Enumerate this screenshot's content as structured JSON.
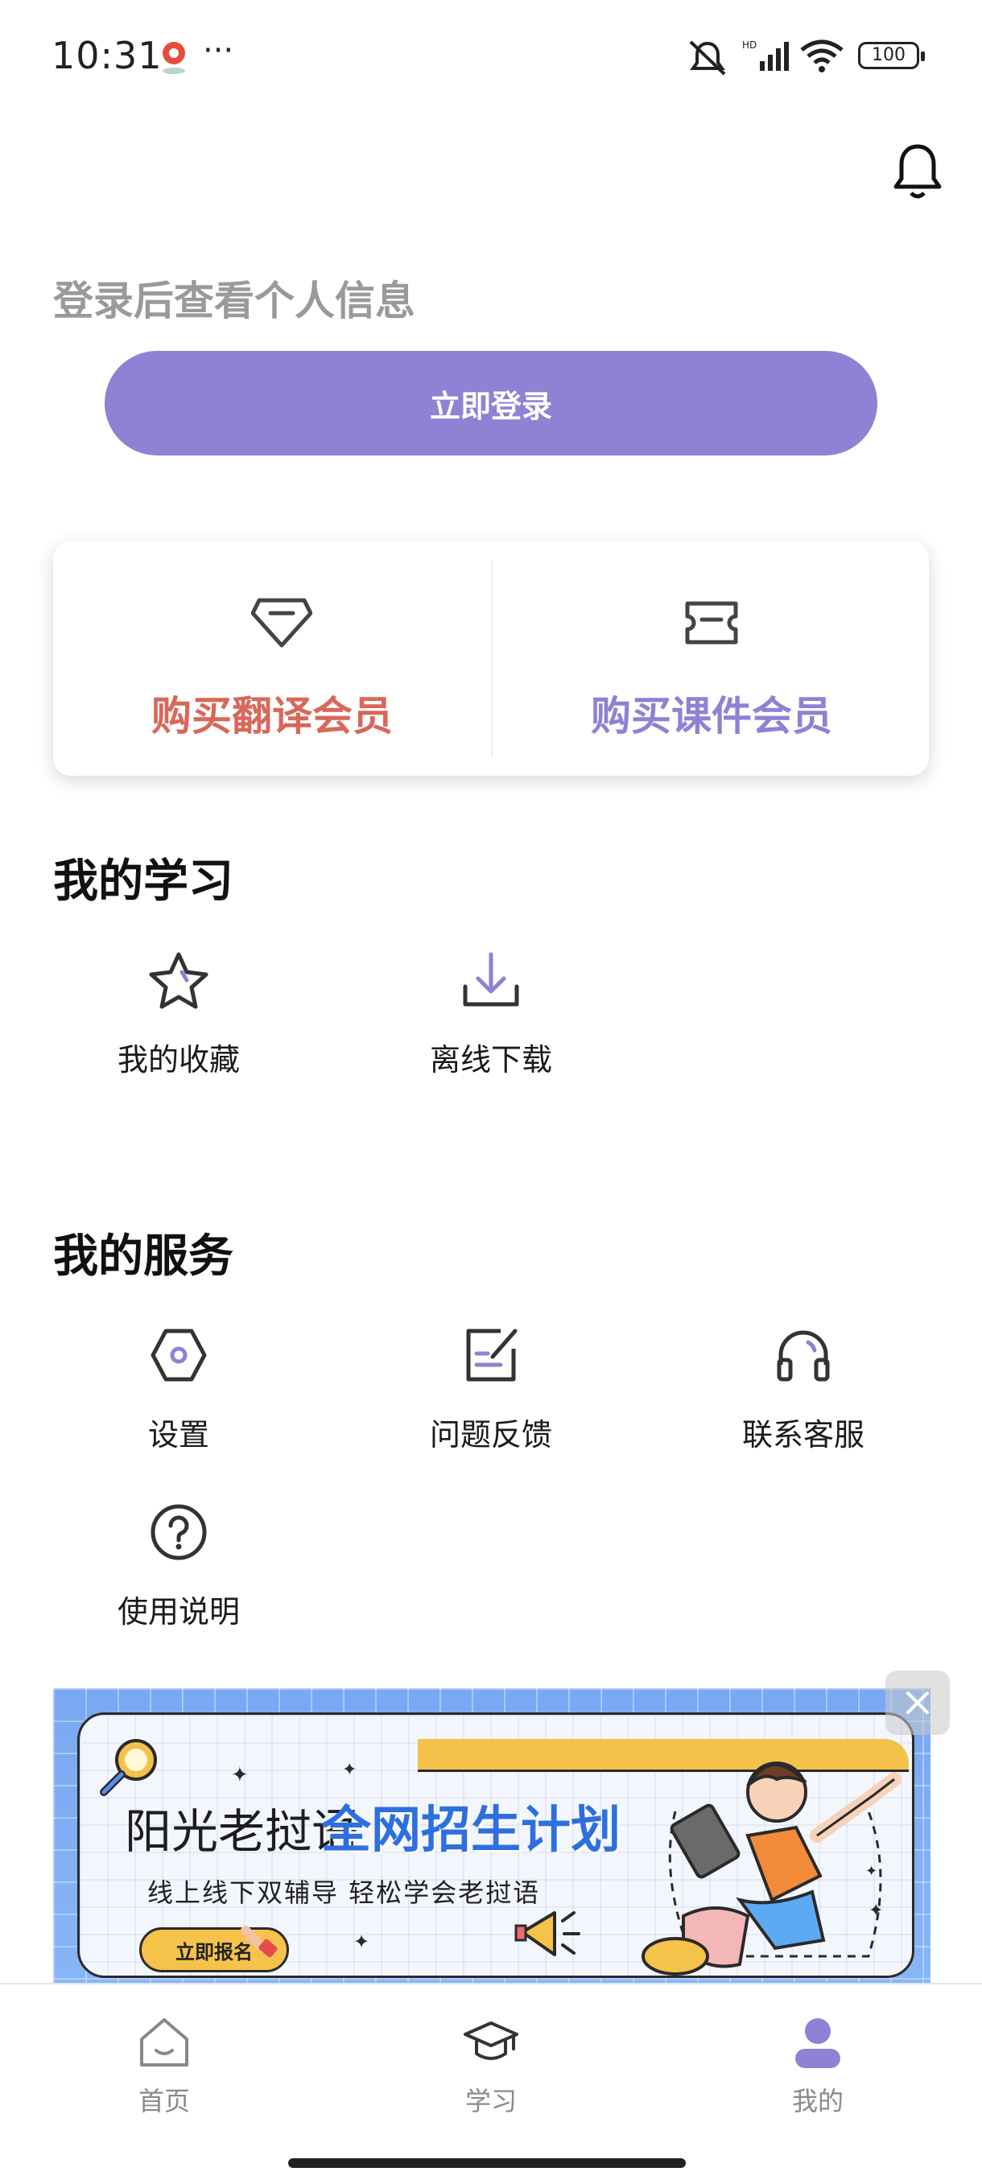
{
  "status_bar": {
    "time": "10:31",
    "dots": "···",
    "battery": "100"
  },
  "header": {
    "login_hint": "登录后查看个人信息",
    "login_button": "立即登录"
  },
  "membership": {
    "translate": {
      "label": "购买翻译会员",
      "icon": "diamond-icon",
      "color": "#d9675a"
    },
    "courseware": {
      "label": "购买课件会员",
      "icon": "ticket-icon",
      "color": "#8d82d3"
    }
  },
  "my_learning": {
    "title": "我的学习",
    "items": [
      {
        "label": "我的收藏",
        "icon": "star-icon"
      },
      {
        "label": "离线下载",
        "icon": "download-icon"
      }
    ]
  },
  "my_services": {
    "title": "我的服务",
    "items": [
      {
        "label": "设置",
        "icon": "settings-icon"
      },
      {
        "label": "问题反馈",
        "icon": "feedback-icon"
      },
      {
        "label": "联系客服",
        "icon": "headset-icon"
      },
      {
        "label": "使用说明",
        "icon": "help-icon"
      }
    ]
  },
  "banner": {
    "title_part1": "阳光老挝语",
    "title_part2": "全网招生计划",
    "subtitle": "线上线下双辅导 轻松学会老挝语",
    "button": "立即报名"
  },
  "bottom_nav": {
    "items": [
      {
        "label": "首页",
        "icon": "home-icon",
        "active": false
      },
      {
        "label": "学习",
        "icon": "graduation-cap-icon",
        "active": false
      },
      {
        "label": "我的",
        "icon": "profile-icon",
        "active": true
      }
    ],
    "active_color": "#8d82d3"
  }
}
